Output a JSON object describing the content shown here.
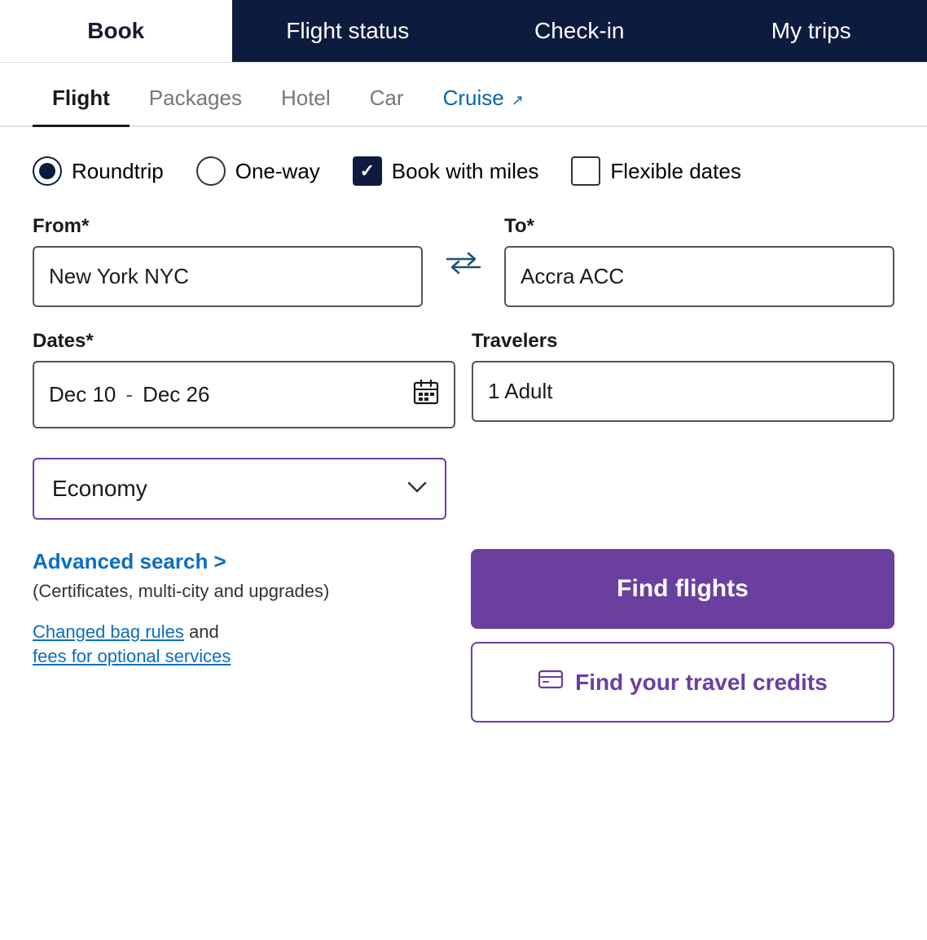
{
  "topNav": {
    "items": [
      {
        "id": "book",
        "label": "Book",
        "active": true,
        "dark": false
      },
      {
        "id": "flight-status",
        "label": "Flight status",
        "active": false,
        "dark": true
      },
      {
        "id": "check-in",
        "label": "Check-in",
        "active": false,
        "dark": true
      },
      {
        "id": "my-trips",
        "label": "My trips",
        "active": false,
        "dark": true
      }
    ]
  },
  "subNav": {
    "items": [
      {
        "id": "flight",
        "label": "Flight",
        "active": true,
        "cruise": false
      },
      {
        "id": "packages",
        "label": "Packages",
        "active": false,
        "cruise": false
      },
      {
        "id": "hotel",
        "label": "Hotel",
        "active": false,
        "cruise": false
      },
      {
        "id": "car",
        "label": "Car",
        "active": false,
        "cruise": false
      },
      {
        "id": "cruise",
        "label": "Cruise",
        "active": false,
        "cruise": true
      }
    ]
  },
  "tripType": {
    "roundtrip": {
      "label": "Roundtrip",
      "selected": true
    },
    "oneway": {
      "label": "One-way",
      "selected": false
    },
    "bookWithMiles": {
      "label": "Book with miles",
      "checked": true
    },
    "flexibleDates": {
      "label": "Flexible dates",
      "checked": false
    }
  },
  "from": {
    "label": "From*",
    "value": "New York NYC",
    "placeholder": "From"
  },
  "to": {
    "label": "To*",
    "value": "Accra ACC",
    "placeholder": "To"
  },
  "dates": {
    "label": "Dates*",
    "departure": "Dec 10",
    "separator": "-",
    "return": "Dec 26"
  },
  "travelers": {
    "label": "Travelers",
    "value": "1 Adult"
  },
  "cabin": {
    "value": "Economy",
    "chevron": "∨"
  },
  "advancedSearch": {
    "label": "Advanced search >",
    "sublabel": "(Certificates, multi-city and upgrades)"
  },
  "links": {
    "bagRules": "Changed bag rules",
    "bagRulesAnd": " and",
    "feesOptional": "fees for optional services"
  },
  "buttons": {
    "findFlights": "Find flights",
    "travelCredits": "Find your travel credits"
  }
}
